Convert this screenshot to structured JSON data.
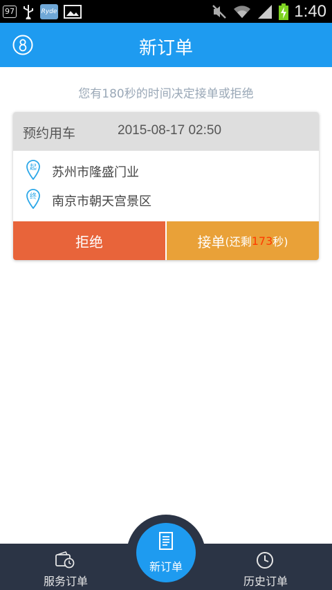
{
  "status_bar": {
    "notification_count": "97",
    "app_badge": "Ryde",
    "time": "1:40"
  },
  "header": {
    "title": "新订单",
    "profile_icon": "profile-icon"
  },
  "hint": "您有180秒的时间决定接单或拒绝",
  "order": {
    "type": "预约用车",
    "datetime": "2015-08-17 02:50",
    "start_tag": "起",
    "start": "苏州市隆盛门业",
    "end_tag": "终",
    "end": "南京市朝天宫景区",
    "reject_label": "拒绝",
    "accept_label": "接单",
    "remain_prefix": "(还剩",
    "remain_seconds": "173",
    "remain_suffix": "秒)"
  },
  "bottom_nav": {
    "left_label": "服务订单",
    "center_label": "新订单",
    "right_label": "历史订单"
  },
  "colors": {
    "primary": "#1e9bf0",
    "reject": "#e8643a",
    "accept": "#e9a138",
    "countdown": "#ff3b00",
    "nav_bg": "#2b3445"
  }
}
